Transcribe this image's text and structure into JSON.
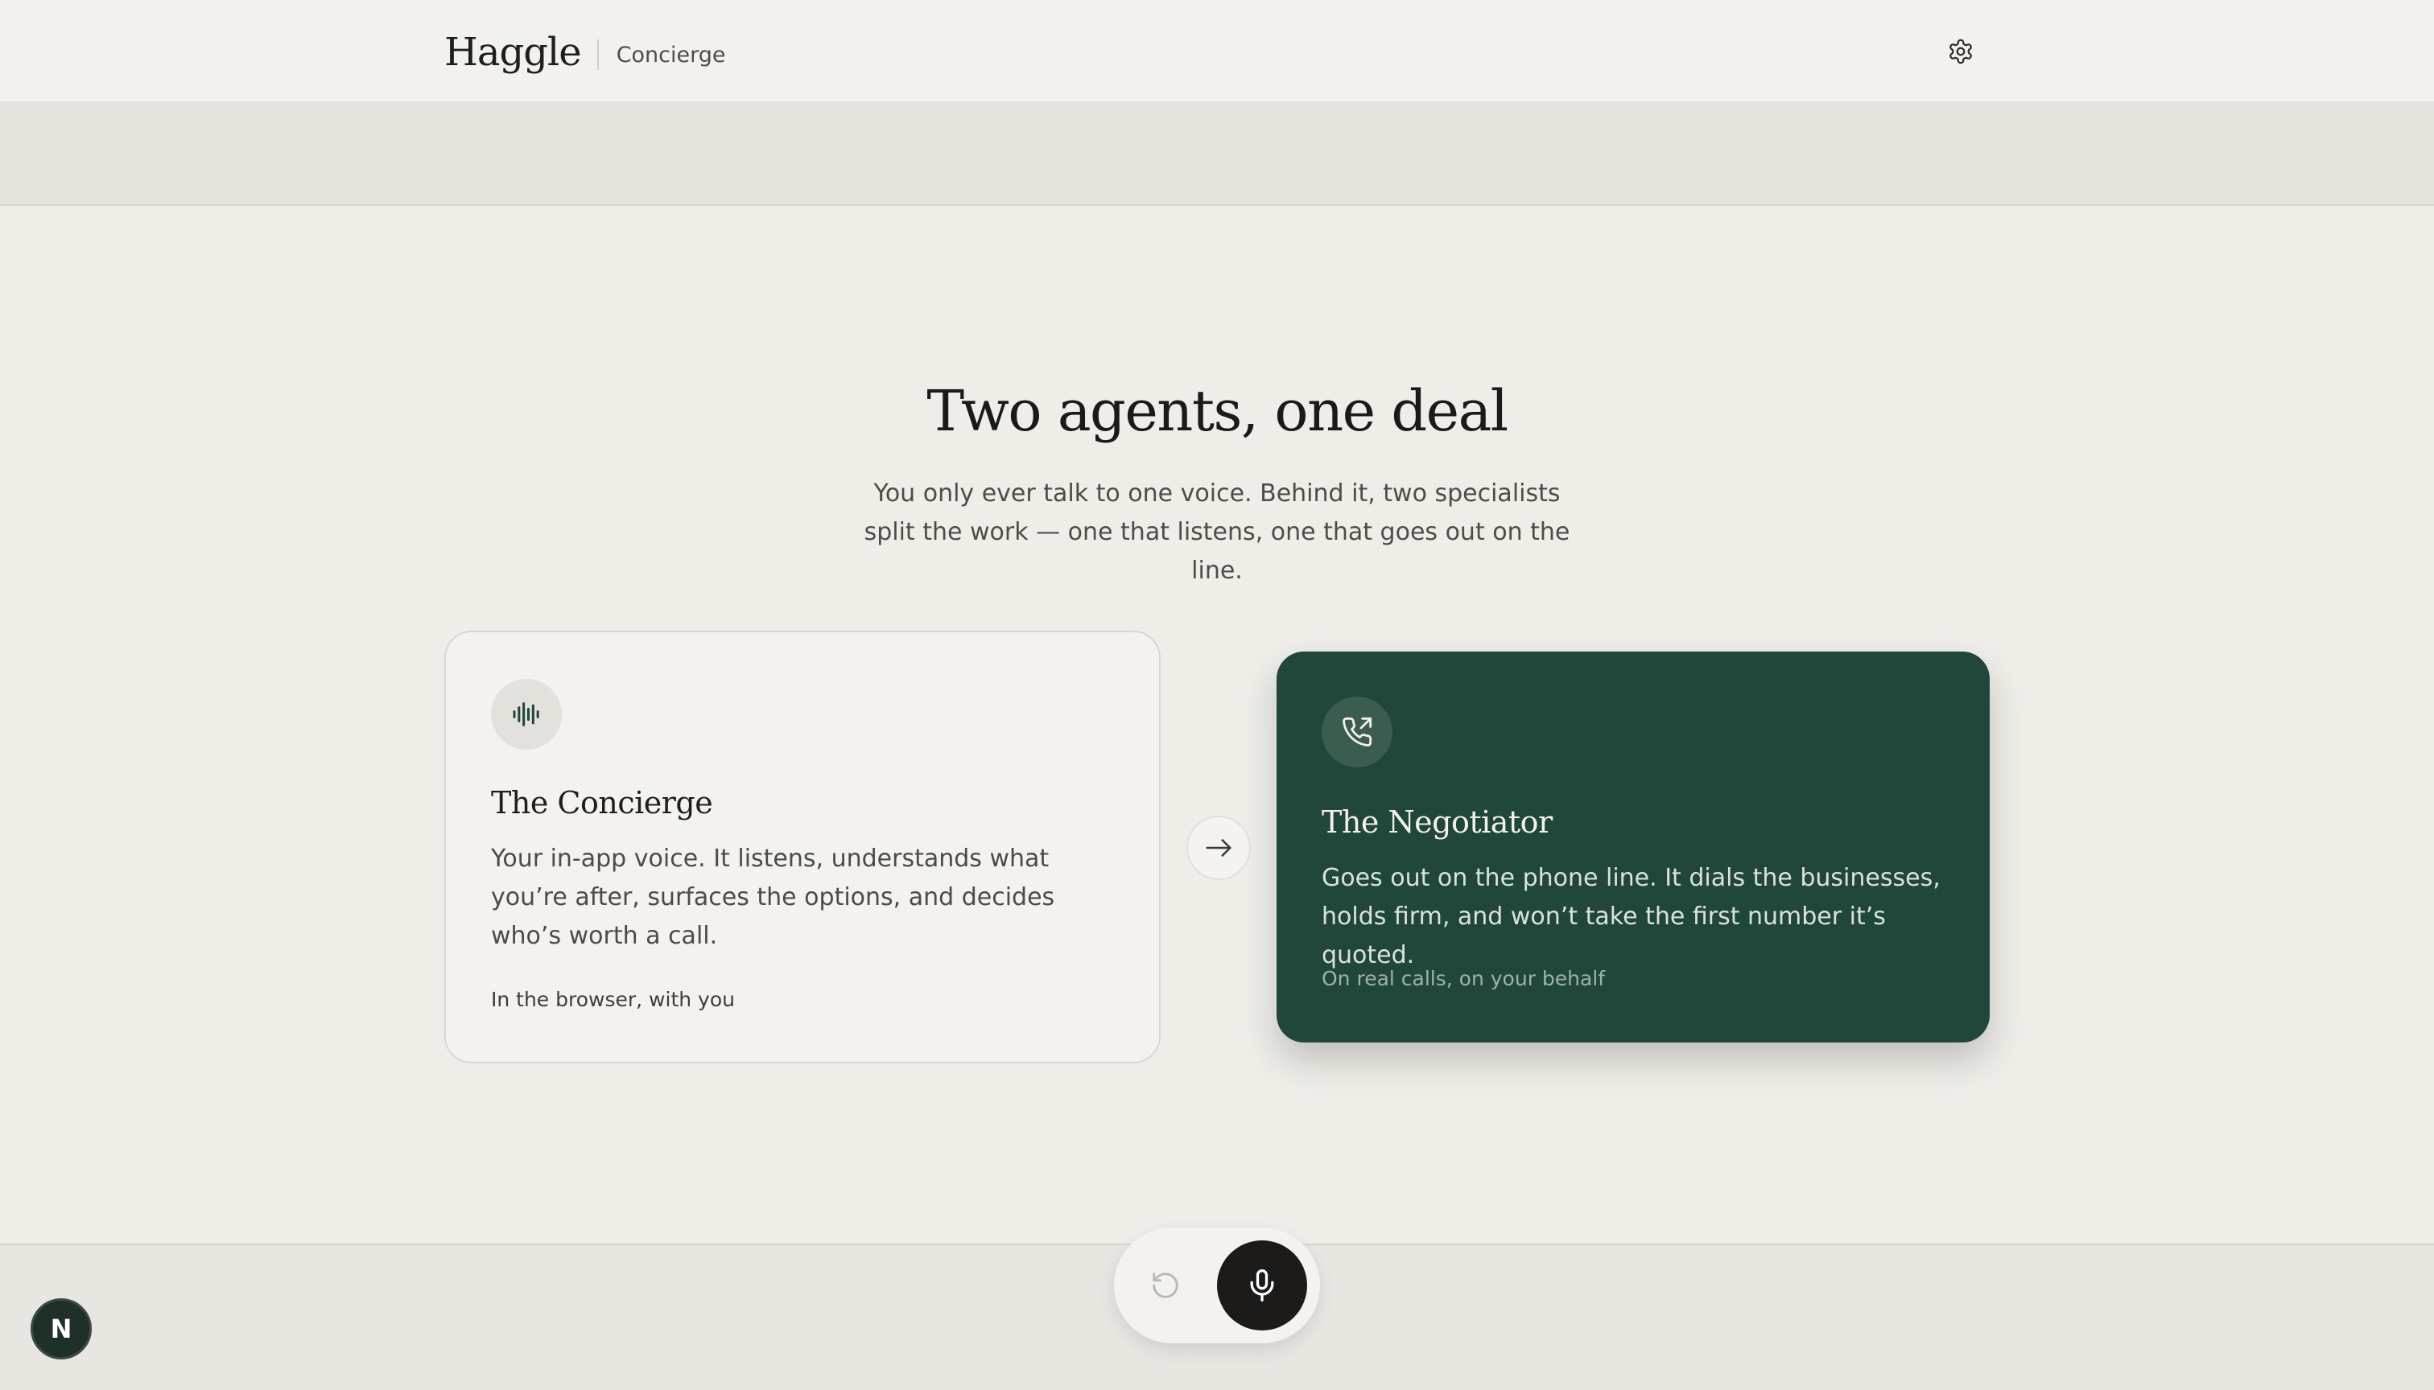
{
  "header": {
    "brand": "Haggle",
    "section": "Concierge"
  },
  "hero": {
    "title": "Two agents, one deal",
    "subtitle": "You only ever talk to one voice. Behind it, two specialists split the work — one that listens, one that goes out on the line."
  },
  "cards": [
    {
      "icon": "audio-waveform-icon",
      "title": "The Concierge",
      "body": "Your in-app voice. It listens, understands what you’re after, surfaces the options, and decides who’s worth a call.",
      "footer": "In the browser, with you"
    },
    {
      "icon": "phone-outgoing-icon",
      "title": "The Negotiator",
      "body": "Goes out on the phone line. It dials the businesses, holds firm, and won’t take the first number it’s quoted.",
      "footer": "On real calls, on your behalf"
    }
  ],
  "connector": {
    "icon": "arrow-right-icon"
  },
  "controls": {
    "reset_icon": "reset-icon",
    "mic_icon": "microphone-icon"
  },
  "avatar": {
    "initial": "N"
  },
  "colors": {
    "background": "#efede8",
    "accent_green": "#20473a",
    "mic_button": "#1c1b19"
  }
}
